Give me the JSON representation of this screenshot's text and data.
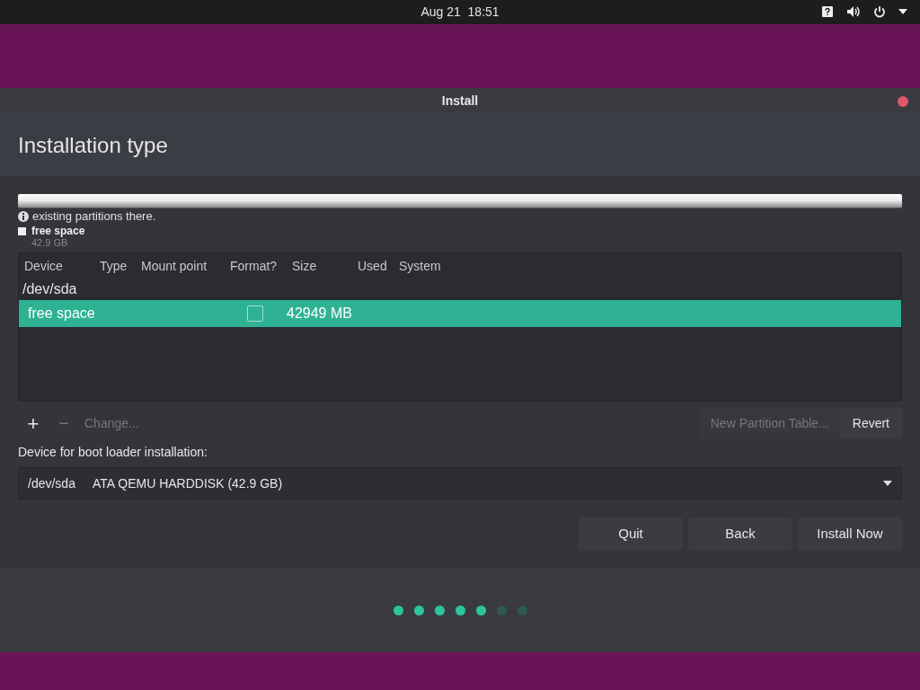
{
  "top_bar": {
    "clock": "Aug 21  18:51"
  },
  "window": {
    "title": "Install"
  },
  "heading": "Installation type",
  "note": "existing partitions there.",
  "legend": {
    "label": "free space",
    "size": "42.9 GB"
  },
  "table": {
    "columns": [
      "Device",
      "Type",
      "Mount point",
      "Format?",
      "Size",
      "Used",
      "System"
    ],
    "rows": [
      {
        "kind": "disk",
        "device": "/dev/sda",
        "selected": false
      },
      {
        "kind": "partition",
        "device": "free space",
        "format": false,
        "size": "42949 MB",
        "selected": true
      }
    ]
  },
  "toolbar": {
    "add": "+",
    "remove": "−",
    "change": "Change...",
    "new_table": "New Partition Table...",
    "revert": "Revert"
  },
  "boot_loader": {
    "label": "Device for boot loader installation:",
    "device": "/dev/sda",
    "description": "ATA QEMU HARDDISK (42.9 GB)"
  },
  "buttons": [
    "Quit",
    "Back",
    "Install Now"
  ],
  "steps": [
    {
      "done": true
    },
    {
      "done": true
    },
    {
      "done": true
    },
    {
      "done": true
    },
    {
      "done": true
    },
    {
      "done": false
    },
    {
      "done": false
    }
  ]
}
